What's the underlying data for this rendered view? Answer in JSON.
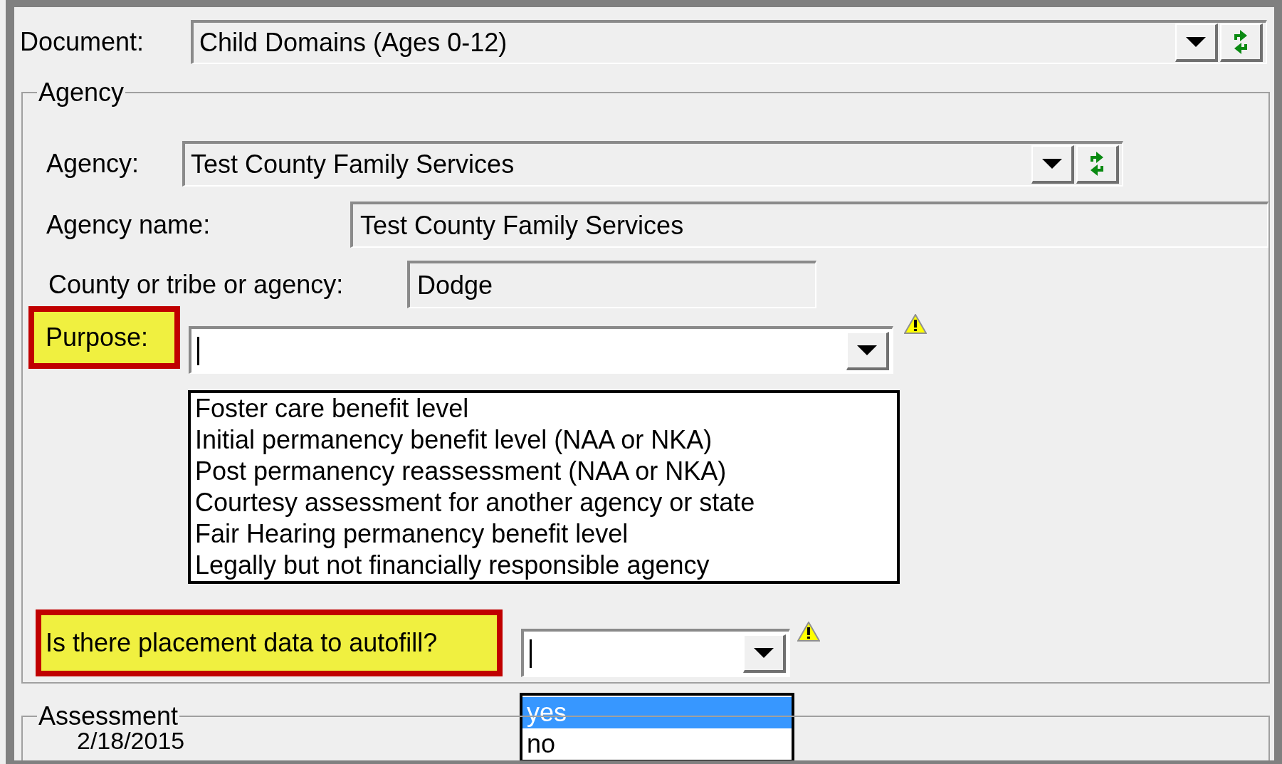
{
  "document": {
    "label": "Document:",
    "value": "Child Domains (Ages 0-12)"
  },
  "agency_group": {
    "title": "Agency",
    "agency": {
      "label": "Agency:",
      "value": "Test County Family Services"
    },
    "agency_name": {
      "label": "Agency name:",
      "value": "Test County Family Services"
    },
    "county": {
      "label": "County or tribe or agency:",
      "value": "Dodge"
    },
    "purpose": {
      "label": "Purpose:",
      "highlighted": true,
      "warning": true,
      "expanded": true,
      "options": [
        {
          "label": "Foster care benefit level",
          "selected": false
        },
        {
          "label": "Initial permanency benefit level (NAA or NKA)",
          "selected": false
        },
        {
          "label": "Post permanency reassessment (NAA or NKA)",
          "selected": false
        },
        {
          "label": "Courtesy assessment for another agency or state",
          "selected": false
        },
        {
          "label": "Fair Hearing permanency benefit level",
          "selected": false
        },
        {
          "label": "Legally but not financially responsible agency",
          "selected": false
        }
      ]
    },
    "autofill": {
      "label": "Is there placement data to autofill?",
      "highlighted": true,
      "warning": true,
      "expanded": true,
      "options": [
        {
          "label": "yes",
          "selected": true
        },
        {
          "label": "no",
          "selected": false
        }
      ]
    }
  },
  "assessment_group": {
    "title": "Assessment",
    "date": "2/18/2015"
  }
}
